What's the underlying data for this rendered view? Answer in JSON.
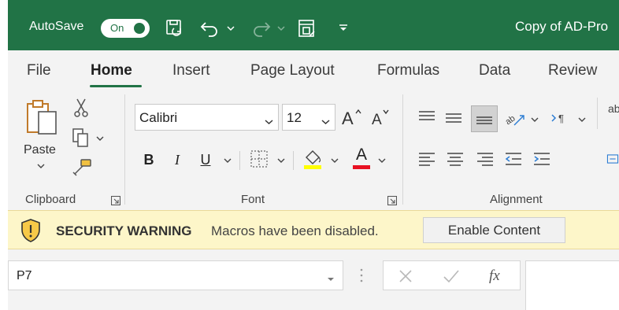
{
  "titlebar": {
    "autosave_label": "AutoSave",
    "toggle_label": "On",
    "document_title": "Copy of AD-Pro",
    "brand_color": "#217346"
  },
  "tabs": [
    {
      "label": "File"
    },
    {
      "label": "Home",
      "active": true
    },
    {
      "label": "Insert"
    },
    {
      "label": "Page Layout"
    },
    {
      "label": "Formulas"
    },
    {
      "label": "Data"
    },
    {
      "label": "Review"
    }
  ],
  "ribbon": {
    "clipboard": {
      "label": "Clipboard",
      "paste_label": "Paste"
    },
    "font": {
      "label": "Font",
      "font_name": "Calibri",
      "font_size": "12",
      "bold": "B",
      "italic": "I",
      "underline": "U",
      "font_color_letter": "A",
      "highlight_color": "#ffff00",
      "font_color": "#e81123"
    },
    "alignment": {
      "label": "Alignment",
      "partial_glyph": "ab"
    }
  },
  "security_bar": {
    "title": "SECURITY WARNING",
    "message": "Macros have been disabled.",
    "button_label": "Enable Content"
  },
  "formula_bar": {
    "name_box": "P7",
    "fx_label": "fx"
  }
}
